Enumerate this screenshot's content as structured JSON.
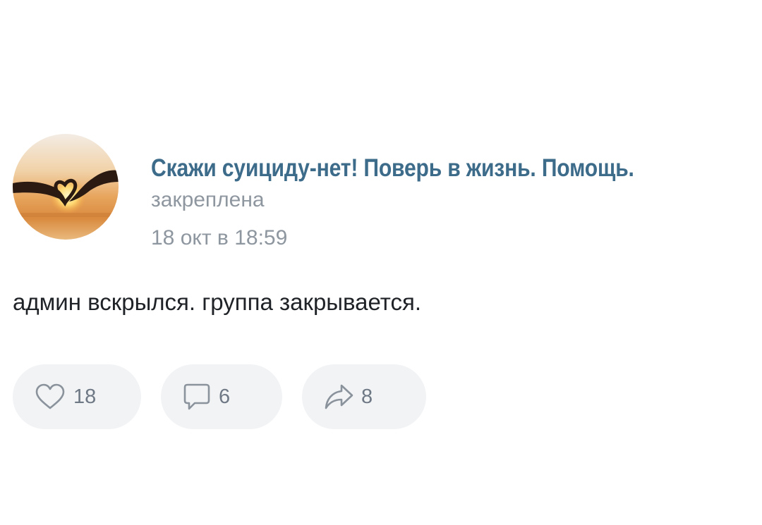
{
  "post": {
    "group_name": "Скажи суициду-нет! Поверь в жизнь. Помощь.",
    "pinned_label": "закреплена",
    "timestamp": "18 окт в 18:59",
    "text": "админ вскрылся. группа закрывается."
  },
  "actions": {
    "likes": "18",
    "comments": "6",
    "shares": "8"
  },
  "icons": {
    "like": "heart-icon",
    "comment": "comment-icon",
    "share": "share-arrow-icon"
  },
  "colors": {
    "group_name": "#3d6b8a",
    "meta_text": "#8e969f",
    "body_text": "#1f2226",
    "action_bg": "#f2f3f5",
    "action_icon": "#8a929c"
  }
}
